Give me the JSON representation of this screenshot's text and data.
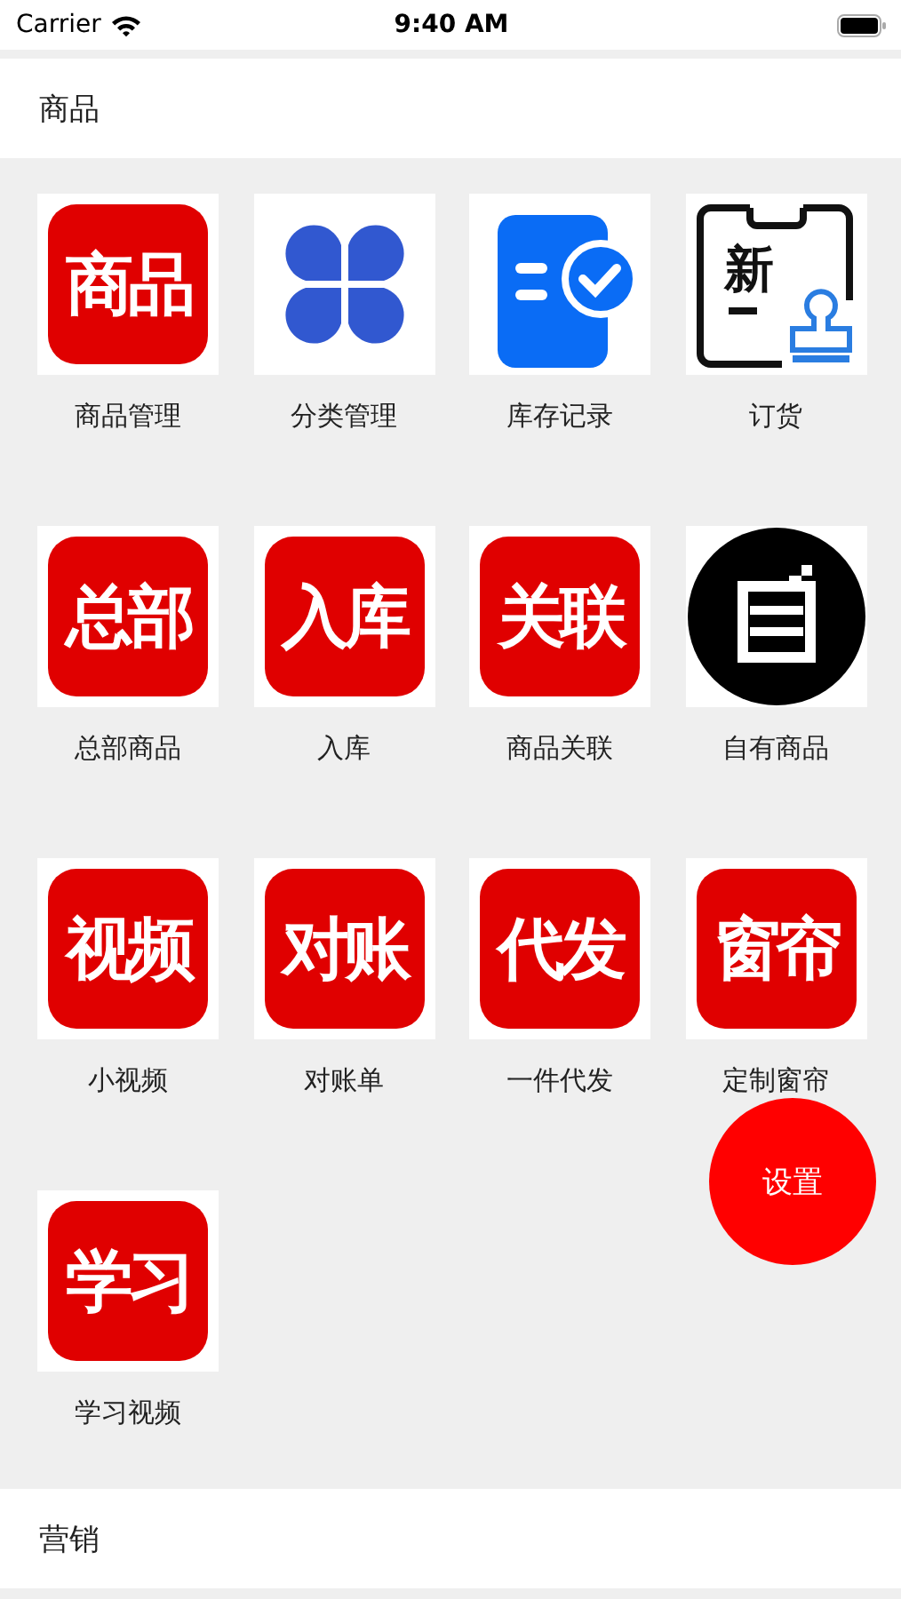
{
  "status_bar": {
    "carrier": "Carrier",
    "time": "9:40 AM"
  },
  "sections": [
    {
      "title": "商品",
      "items": [
        {
          "kind": "red-text",
          "icon_text": "商品",
          "label": "商品管理"
        },
        {
          "kind": "clover",
          "label": "分类管理"
        },
        {
          "kind": "doc-check",
          "label": "库存记录"
        },
        {
          "kind": "order",
          "icon_text": "新",
          "label": "订货"
        },
        {
          "kind": "red-text",
          "icon_text": "总部",
          "label": "总部商品"
        },
        {
          "kind": "red-text",
          "icon_text": "入库",
          "label": "入库"
        },
        {
          "kind": "red-text",
          "icon_text": "关联",
          "label": "商品关联"
        },
        {
          "kind": "self",
          "label": "自有商品"
        },
        {
          "kind": "red-text",
          "icon_text": "视频",
          "label": "小视频"
        },
        {
          "kind": "red-text",
          "icon_text": "对账",
          "label": "对账单"
        },
        {
          "kind": "red-text",
          "icon_text": "代发",
          "label": "一件代发"
        },
        {
          "kind": "red-text",
          "icon_text": "窗帘",
          "label": "定制窗帘"
        },
        {
          "kind": "red-text",
          "icon_text": "学习",
          "label": "学习视频"
        }
      ]
    },
    {
      "title": "营销"
    }
  ],
  "fab": {
    "label": "设置"
  }
}
